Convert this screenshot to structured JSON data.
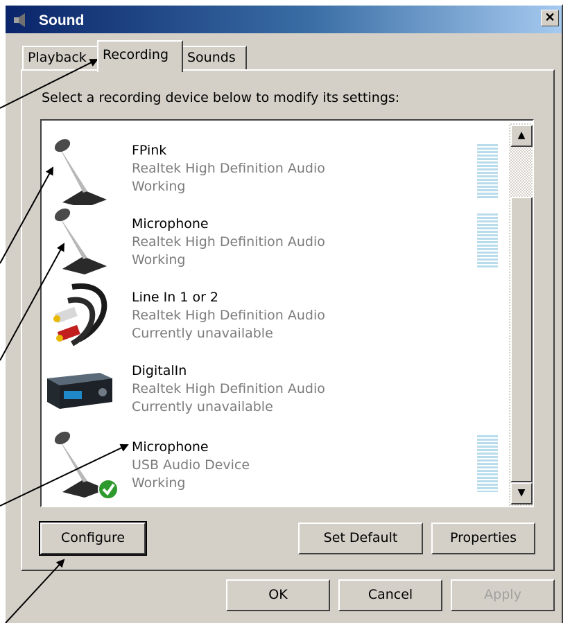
{
  "window": {
    "title": "Sound",
    "close_label": "✕"
  },
  "tabs": [
    {
      "label": "Playback",
      "active": false
    },
    {
      "label": "Recording",
      "active": true
    },
    {
      "label": "Sounds",
      "active": false
    }
  ],
  "instruction": "Select a recording device below to modify its settings:",
  "devices": [
    {
      "name": "FPink",
      "driver": "Realtek High Definition Audio",
      "status": "Working",
      "icon": "microphone-icon",
      "default": false
    },
    {
      "name": "Microphone",
      "driver": "Realtek High Definition Audio",
      "status": "Working",
      "icon": "microphone-icon",
      "default": false
    },
    {
      "name": "Line In 1 or 2",
      "driver": "Realtek High Definition Audio",
      "status": "Currently unavailable",
      "icon": "line-in-cable-icon",
      "default": false
    },
    {
      "name": "DigitalIn",
      "driver": "Realtek High Definition Audio",
      "status": "Currently unavailable",
      "icon": "digital-input-device-icon",
      "default": false
    },
    {
      "name": "Microphone",
      "driver": "USB Audio Device",
      "status": "Working",
      "icon": "microphone-icon",
      "default": true
    }
  ],
  "buttons": {
    "configure": "Configure",
    "set_default": "Set Default",
    "properties": "Properties",
    "ok": "OK",
    "cancel": "Cancel",
    "apply": "Apply"
  },
  "colors": {
    "title_start": "#0a246a",
    "title_end": "#a6caf0",
    "meter": "#b8dceb",
    "check": "#2e9a2e"
  }
}
